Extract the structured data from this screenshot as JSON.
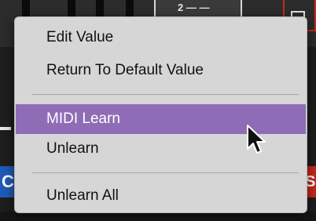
{
  "background": {
    "numbox_text": "2 — —",
    "blue_glyph": "C",
    "red_glyph": "S"
  },
  "menu": {
    "items": [
      {
        "label": "Edit Value"
      },
      {
        "label": "Return To Default Value"
      },
      {
        "label": "MIDI Learn",
        "highlighted": true
      },
      {
        "label": "Unlearn"
      },
      {
        "label": "Unlearn All"
      }
    ]
  },
  "colors": {
    "menu_bg": "#d6d6d6",
    "highlight": "#8e6db6",
    "accent_blue": "#1e5bb8",
    "accent_red": "#c8281e"
  },
  "icons": {
    "cursor": "arrow-pointer-icon"
  }
}
